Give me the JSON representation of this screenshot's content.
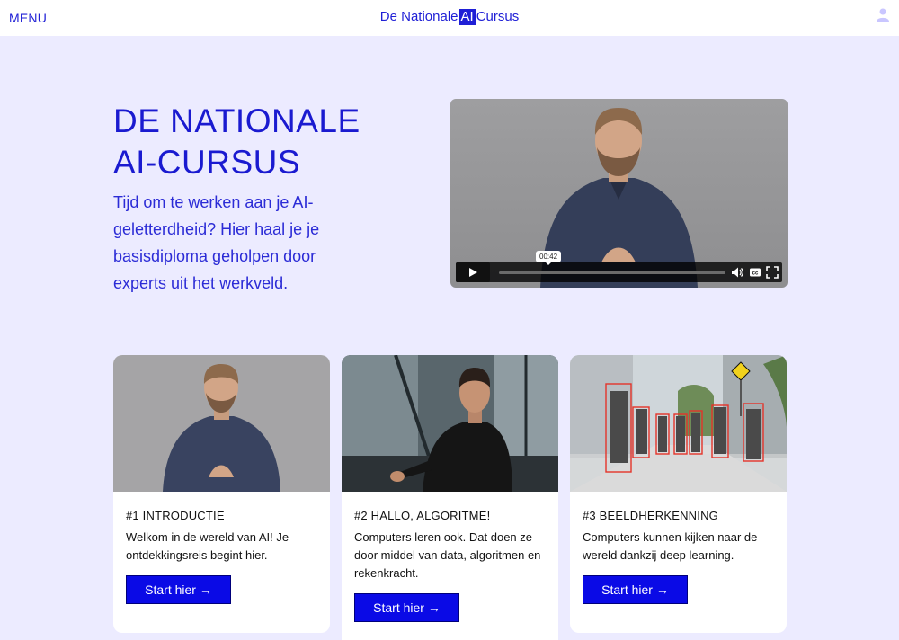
{
  "header": {
    "menu_label": "MENU",
    "brand_prefix": "De Nationale",
    "brand_ai": "AI",
    "brand_suffix": "Cursus",
    "accent_color": "#1f1fd6"
  },
  "hero": {
    "title_line1": "DE NATIONALE",
    "title_line2": "AI-CURSUS",
    "subtitle": "Tijd om te werken aan je AI-geletterdheid? Hier haal je je basisdiploma geholpen door experts uit het werkveld."
  },
  "video": {
    "time_tooltip": "00:42",
    "controls": [
      "play-icon",
      "volume-icon",
      "captions-icon",
      "fullscreen-icon"
    ],
    "captions_label": "cc"
  },
  "cards": [
    {
      "title": "#1 INTRODUCTIE",
      "description": "Welkom in de wereld van AI! Je ontdekkingsreis begint hier.",
      "button": "Start hier →"
    },
    {
      "title": "#2 HALLO, ALGORITME!",
      "description": "Computers leren ook. Dat doen ze door middel van data, algoritmen en rekenkracht.",
      "button": "Start hier →"
    },
    {
      "title": "#3 BEELDHERKENNING",
      "description": "Computers kunnen kijken naar de wereld dankzij deep learning.",
      "button": "Start hier →"
    }
  ],
  "colors": {
    "page_background": "#ecebff",
    "button": "#0a0ae6",
    "heading": "#1a1ad0"
  }
}
